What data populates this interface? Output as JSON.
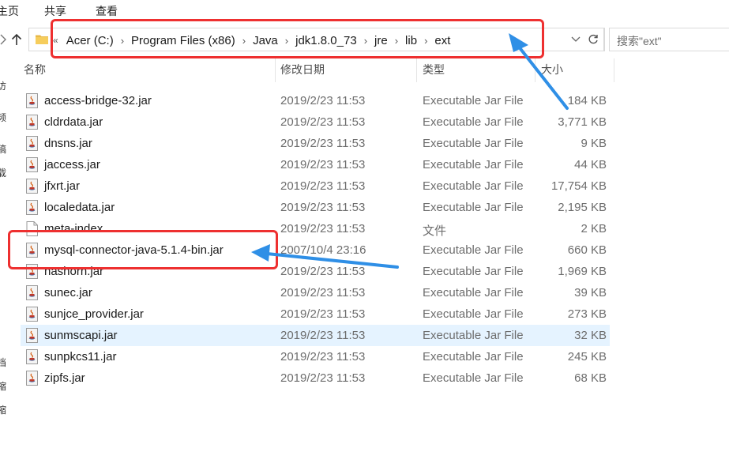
{
  "ribbon": {
    "tabs": [
      "主页",
      "共享",
      "查看"
    ]
  },
  "nav": {
    "up_icon": "up-arrow-icon"
  },
  "address": {
    "leading": "«",
    "crumbs": [
      "Acer (C:)",
      "Program Files (x86)",
      "Java",
      "jdk1.8.0_73",
      "jre",
      "lib",
      "ext"
    ]
  },
  "search": {
    "placeholder": "搜索\"ext\""
  },
  "columns": {
    "name": "名称",
    "date": "修改日期",
    "type": "类型",
    "size": "大小"
  },
  "files": [
    {
      "name": "access-bridge-32.jar",
      "date": "2019/2/23 11:53",
      "type": "Executable Jar File",
      "size": "184 KB",
      "icon": "jar-file-icon"
    },
    {
      "name": "cldrdata.jar",
      "date": "2019/2/23 11:53",
      "type": "Executable Jar File",
      "size": "3,771 KB",
      "icon": "jar-file-icon"
    },
    {
      "name": "dnsns.jar",
      "date": "2019/2/23 11:53",
      "type": "Executable Jar File",
      "size": "9 KB",
      "icon": "jar-file-icon"
    },
    {
      "name": "jaccess.jar",
      "date": "2019/2/23 11:53",
      "type": "Executable Jar File",
      "size": "44 KB",
      "icon": "jar-file-icon"
    },
    {
      "name": "jfxrt.jar",
      "date": "2019/2/23 11:53",
      "type": "Executable Jar File",
      "size": "17,754 KB",
      "icon": "jar-file-icon"
    },
    {
      "name": "localedata.jar",
      "date": "2019/2/23 11:53",
      "type": "Executable Jar File",
      "size": "2,195 KB",
      "icon": "jar-file-icon"
    },
    {
      "name": "meta-index",
      "date": "2019/2/23 11:53",
      "type": "文件",
      "size": "2 KB",
      "icon": "blank-file-icon"
    },
    {
      "name": "mysql-connector-java-5.1.4-bin.jar",
      "date": "2007/10/4 23:16",
      "type": "Executable Jar File",
      "size": "660 KB",
      "icon": "jar-file-icon"
    },
    {
      "name": "nashorn.jar",
      "date": "2019/2/23 11:53",
      "type": "Executable Jar File",
      "size": "1,969 KB",
      "icon": "jar-file-icon"
    },
    {
      "name": "sunec.jar",
      "date": "2019/2/23 11:53",
      "type": "Executable Jar File",
      "size": "39 KB",
      "icon": "jar-file-icon"
    },
    {
      "name": "sunjce_provider.jar",
      "date": "2019/2/23 11:53",
      "type": "Executable Jar File",
      "size": "273 KB",
      "icon": "jar-file-icon"
    },
    {
      "name": "sunmscapi.jar",
      "date": "2019/2/23 11:53",
      "type": "Executable Jar File",
      "size": "32 KB",
      "icon": "jar-file-icon",
      "selected": true
    },
    {
      "name": "sunpkcs11.jar",
      "date": "2019/2/23 11:53",
      "type": "Executable Jar File",
      "size": "245 KB",
      "icon": "jar-file-icon"
    },
    {
      "name": "zipfs.jar",
      "date": "2019/2/23 11:53",
      "type": "Executable Jar File",
      "size": "68 KB",
      "icon": "jar-file-icon"
    }
  ],
  "left_pane_glyphs": [
    "访",
    "频",
    "稿",
    "载",
    "档",
    "缩",
    "缩"
  ],
  "colors": {
    "highlight": "#ee3030",
    "arrow": "#2f8fe6",
    "selected_row": "#e5f3ff"
  }
}
